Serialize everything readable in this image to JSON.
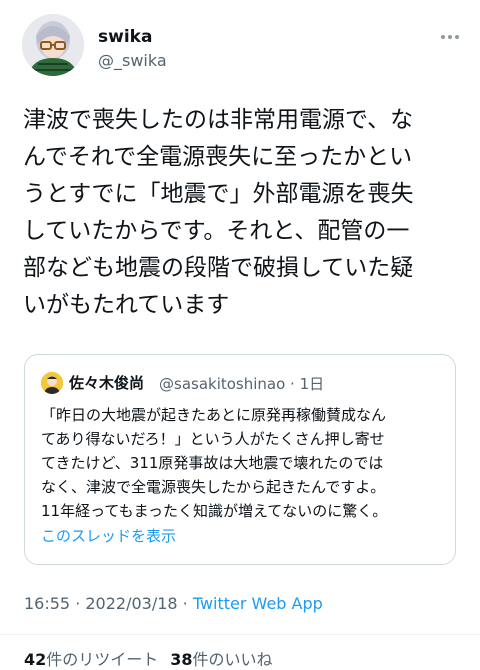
{
  "author": {
    "name": "swika",
    "handle": "@_swika"
  },
  "more_icon": "ellipsis-icon",
  "tweet": {
    "lines": [
      "津波で喪失したのは非常用電源で、な",
      "んでそれで全電源喪失に至ったかとい",
      "うとすでに「地震で」外部電源を喪失",
      "していたからです。それと、配管の一",
      "部なども地震の段階で破損していた疑",
      "いがもたれています"
    ]
  },
  "quote": {
    "name": "佐々木俊尚",
    "meta": "@sasakitoshinao · 1日",
    "lines": [
      "「昨日の大地震が起きたあとに原発再稼働賛成なん",
      "てあり得ないだろ！」という人がたくさん押し寄せ",
      "てきたけど、311原発事故は大地震で壊れたのでは",
      "なく、津波で全電源喪失したから起きたんですよ。",
      "11年経ってもまったく知識が増えてないのに驚く。"
    ],
    "show_thread": "このスレッドを表示"
  },
  "footer": {
    "time": "16:55 · 2022/03/18 · ",
    "source": "Twitter Web App"
  },
  "stats": {
    "retweets_count": "42",
    "retweets_label": "件のリツイート",
    "likes_count": "38",
    "likes_label": "件のいいね"
  },
  "colors": {
    "link": "#1d9bf0",
    "secondary": "#536471",
    "border": "#cfd9de"
  }
}
